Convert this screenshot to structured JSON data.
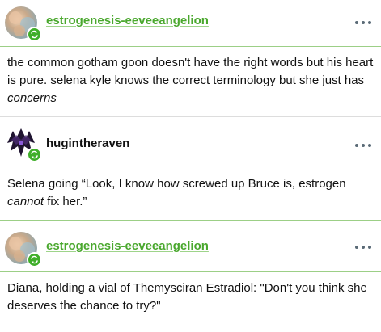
{
  "posts": [
    {
      "username": "estrogenesis-eeveeangelion",
      "avatar_icon": "gradient-avatar-icon",
      "badge_icon": "reblog-icon",
      "text_parts": [
        "the common gotham goon doesn't have the right words but his heart is pure. selena kyle knows the correct terminology but she just has ",
        "concerns",
        ""
      ]
    },
    {
      "username": "hugintheraven",
      "avatar_icon": "raven-avatar-icon",
      "badge_icon": "reblog-icon",
      "text_parts": [
        "Selena going “Look, I know how screwed up Bruce is, estrogen ",
        "cannot",
        " fix her.”"
      ]
    },
    {
      "username": "estrogenesis-eeveeangelion",
      "avatar_icon": "gradient-avatar-icon",
      "badge_icon": "reblog-icon",
      "text_parts": [
        "Diana, holding a vial of Themysciran Estradiol: \"Don't you think she deserves the chance to try?\"",
        "",
        ""
      ]
    }
  ],
  "more_icon": "more-options-icon",
  "colors": {
    "accent_green": "#4aa82e",
    "badge_green": "#3fae2a",
    "divider_green": "#9ccf86",
    "divider_grey": "#dddddd",
    "text": "#111111"
  }
}
